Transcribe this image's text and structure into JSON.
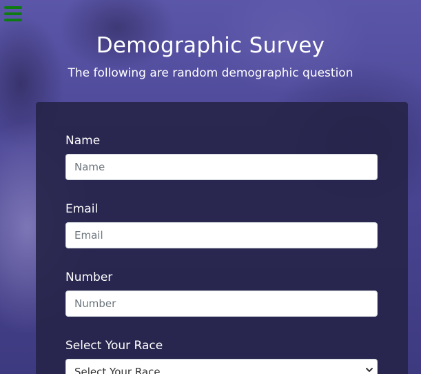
{
  "menu": {
    "icon": "hamburger-menu-icon",
    "color": "#0e7a12"
  },
  "header": {
    "title": "Demographic Survey",
    "subtitle": "The following are random demographic question"
  },
  "form": {
    "name": {
      "label": "Name",
      "placeholder": "Name",
      "value": ""
    },
    "email": {
      "label": "Email",
      "placeholder": "Email",
      "value": ""
    },
    "number": {
      "label": "Number",
      "placeholder": "Number",
      "value": ""
    },
    "race": {
      "label": "Select Your Race",
      "selected": "Select Your Race"
    }
  },
  "colors": {
    "background": "#4c4796",
    "card": "#262348",
    "text": "#ffffff"
  }
}
